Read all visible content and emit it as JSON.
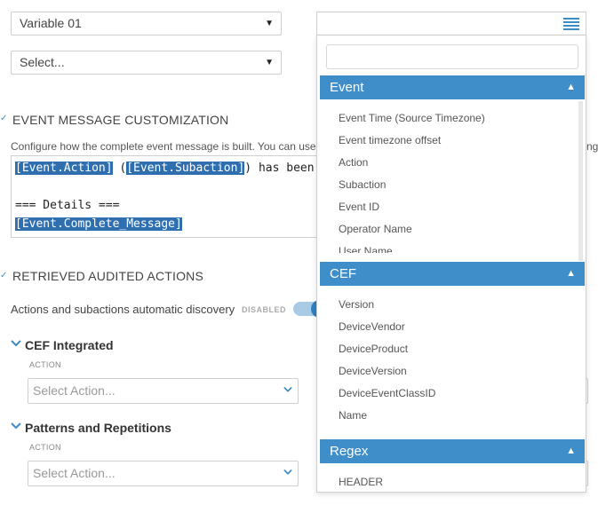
{
  "variable_select": {
    "value": "Variable 01"
  },
  "second_select": {
    "value": "Select..."
  },
  "event_message": {
    "title": "EVENT MESSAGE CUSTOMIZATION",
    "description": "Configure how the complete event message is built. You can use all",
    "description_overflow": "ng",
    "editor": {
      "l1_tok1": "[Event.Action]",
      "l1_mid": " (",
      "l1_tok2": "[Event.Subaction]",
      "l1_tail": ") has been",
      "l3": "=== Details ===",
      "l4_tok": "[Event.Complete_Message]"
    }
  },
  "retrieved": {
    "title": "RETRIEVED AUDITED ACTIONS",
    "toggle_label": "Actions and subactions automatic discovery",
    "toggle_state": "DISABLED"
  },
  "groups": [
    {
      "title": "CEF Integrated",
      "label": "ACTION",
      "placeholder": "Select Action..."
    },
    {
      "title": "Patterns and Repetitions",
      "label": "ACTION",
      "placeholder": "Select Action..."
    }
  ],
  "dropdown": {
    "sections": [
      {
        "name": "Event",
        "items": [
          "Event Time (Source Timezone)",
          "Event timezone offset",
          "Action",
          "Subaction",
          "Event ID",
          "Operator Name",
          "User Name"
        ]
      },
      {
        "name": "CEF",
        "items": [
          "Version",
          "DeviceVendor",
          "DeviceProduct",
          "DeviceVersion",
          "DeviceEventClassID",
          "Name"
        ]
      },
      {
        "name": "Regex",
        "items": [
          "HEADER"
        ]
      }
    ]
  },
  "icons": {
    "menu": "list-menu-icon",
    "caret": "caret-up-icon",
    "chevron": "chevron-down-icon",
    "check": "check-icon"
  },
  "colors": {
    "accent": "#3f8ec9",
    "token": "#2f6fb0"
  }
}
